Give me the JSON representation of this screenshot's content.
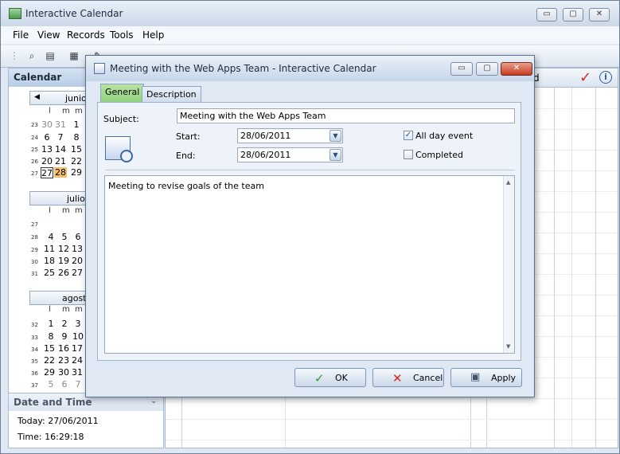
{
  "main": {
    "title": "Interactive Calendar",
    "menu": [
      "File",
      "View",
      "Records",
      "Tools",
      "Help"
    ],
    "window_buttons": [
      "▭",
      "▢",
      "✕"
    ]
  },
  "calendar_pane": {
    "title": "Calendar",
    "months": [
      {
        "name": "junio",
        "dow": [
          "l",
          "m",
          "m"
        ],
        "weeks": [
          {
            "wk": "23",
            "days": [
              "30",
              "31",
              "1"
            ]
          },
          {
            "wk": "24",
            "days": [
              "6",
              "7",
              "8"
            ]
          },
          {
            "wk": "25",
            "days": [
              "13",
              "14",
              "15"
            ]
          },
          {
            "wk": "26",
            "days": [
              "20",
              "21",
              "22"
            ]
          },
          {
            "wk": "27",
            "days": [
              "27",
              "28",
              "29"
            ]
          }
        ]
      },
      {
        "name": "julio 2",
        "dow": [
          "l",
          "m",
          "m"
        ],
        "weeks": [
          {
            "wk": "27",
            "days": [
              "",
              "",
              ""
            ]
          },
          {
            "wk": "28",
            "days": [
              "4",
              "5",
              "6"
            ]
          },
          {
            "wk": "29",
            "days": [
              "11",
              "12",
              "13"
            ]
          },
          {
            "wk": "30",
            "days": [
              "18",
              "19",
              "20"
            ]
          },
          {
            "wk": "31",
            "days": [
              "25",
              "26",
              "27"
            ]
          }
        ]
      },
      {
        "name": "agosto",
        "dow": [
          "l",
          "m",
          "m"
        ],
        "weeks": [
          {
            "wk": "32",
            "days": [
              "1",
              "2",
              "3"
            ]
          },
          {
            "wk": "33",
            "days": [
              "8",
              "9",
              "10"
            ]
          },
          {
            "wk": "34",
            "days": [
              "15",
              "16",
              "17"
            ]
          },
          {
            "wk": "35",
            "days": [
              "22",
              "23",
              "24"
            ]
          },
          {
            "wk": "36",
            "days": [
              "29",
              "30",
              "31"
            ]
          },
          {
            "wk": "37",
            "days": [
              "5",
              "6",
              "7"
            ]
          }
        ]
      }
    ],
    "date_time": {
      "title": "Date and Time",
      "today": "Today: 27/06/2011",
      "time": "Time: 16:29:18"
    }
  },
  "grid": {
    "header_partial": "d",
    "check_icon": "✓",
    "info_icon": "i"
  },
  "dialog": {
    "title": "Meeting with the Web Apps Team - Interactive Calendar",
    "tabs": [
      "General",
      "Description"
    ],
    "subject_label": "Subject:",
    "subject_value": "Meeting with the Web Apps Team",
    "start_label": "Start:",
    "start_value": "28/06/2011",
    "end_label": "End:",
    "end_value": "28/06/2011",
    "all_day_label": "All day event",
    "all_day_checked": true,
    "completed_label": "Completed",
    "completed_checked": false,
    "notes": "Meeting to revise goals of the team",
    "ok_label": "OK",
    "cancel_label": "Cancel",
    "apply_label": "Apply"
  },
  "colors": {
    "selected_day": "#f4c06a",
    "active_tab": "#8fd07c",
    "close_button": "#c63b1f"
  }
}
